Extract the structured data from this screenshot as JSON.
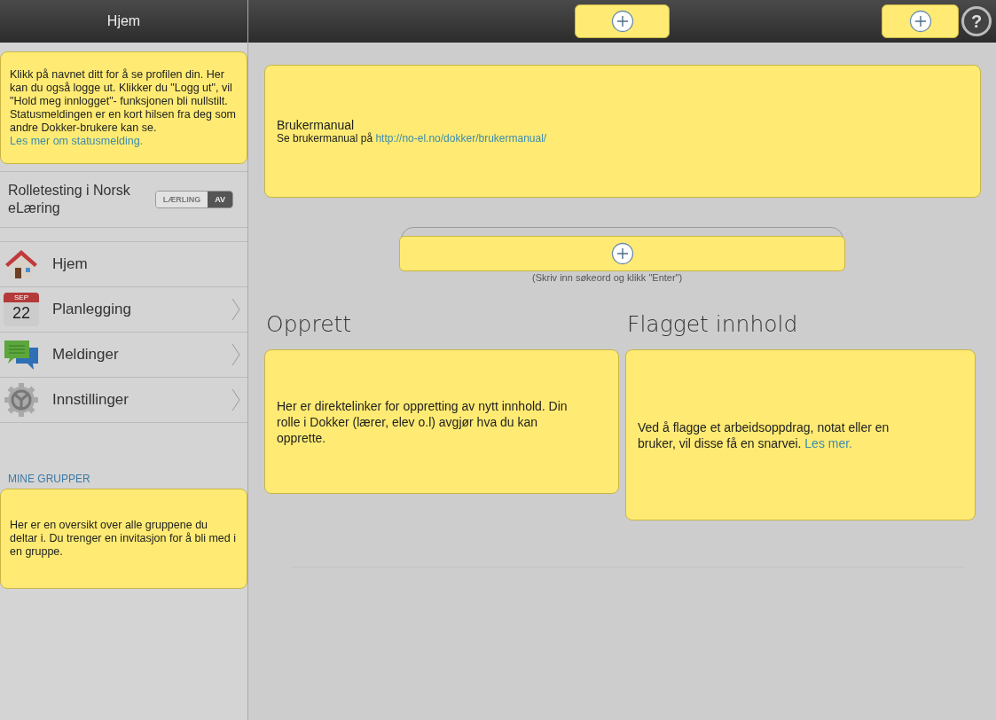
{
  "sidebar": {
    "title": "Hjem",
    "profile_note": {
      "text": "Klikk på navnet ditt for å se profilen din. Her kan du også logge ut. Klikker du \"Logg ut\", vil \"Hold meg innlogget\"- funksjonen bli nullstilt. Statusmeldingen er en kort hilsen fra deg som andre Dokker-brukere kan se.",
      "link": "Les mer om statusmelding."
    },
    "role": {
      "label": "Rolletesting i Norsk eLæring",
      "toggle": [
        {
          "label": "LÆRLING",
          "selected": false
        },
        {
          "label": "AV",
          "selected": true
        }
      ]
    },
    "nav_items": [
      {
        "label": "Hjem",
        "chevron": false
      },
      {
        "label": "Planlegging",
        "chevron": true,
        "calendar": {
          "month": "SEP",
          "day": "22"
        }
      },
      {
        "label": "Meldinger",
        "chevron": true
      },
      {
        "label": "Innstillinger",
        "chevron": true
      }
    ],
    "groups_heading": "MINE GRUPPER",
    "groups_note": {
      "text": "Her er en oversikt over alle gruppene du deltar i. Du trenger en invitasjon for å bli med i en gruppe."
    }
  },
  "topbar": {
    "add_buttons": [
      {
        "kind": "add"
      },
      {
        "kind": "add"
      }
    ],
    "help": "?"
  },
  "manual_note": {
    "title": "Brukermanual",
    "text": "Se brukermanual på",
    "link": "http://no-el.no/dokker/brukermanual/"
  },
  "search": {
    "hint": "(Skriv inn søkeord og klikk \"Enter\")"
  },
  "sections": [
    {
      "heading": "Opprett",
      "note": {
        "text": "Her er direktelinker for oppretting av nytt innhold. Din rolle i Dokker (lærer, elev o.l) avgjør hva du kan opprette."
      }
    },
    {
      "heading": "Flagget innhold",
      "note": {
        "text": "Ved å flagge et arbeidsoppdrag, notat eller en bruker, vil disse få en snarvei.",
        "link": "Les mer."
      }
    }
  ]
}
